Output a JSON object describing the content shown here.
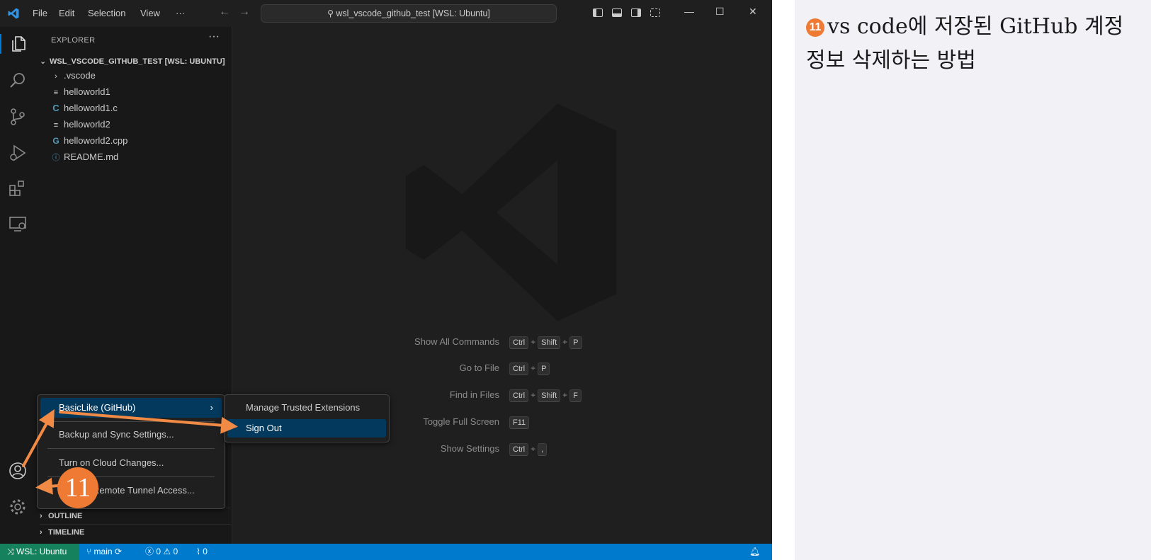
{
  "titlebar": {
    "menu": [
      "File",
      "Edit",
      "Selection",
      "View"
    ],
    "more": "···",
    "search_text": "wsl_vscode_github_test [WSL: Ubuntu]"
  },
  "sidebar": {
    "title": "EXPLORER",
    "more": "···",
    "root": "WSL_VSCODE_GITHUB_TEST [WSL: UBUNTU]",
    "files": [
      {
        "name": ".vscode",
        "icon": "chevron-right-icon"
      },
      {
        "name": "helloworld1",
        "icon": "text-file-icon"
      },
      {
        "name": "helloworld1.c",
        "icon": "c-file-icon"
      },
      {
        "name": "helloworld2",
        "icon": "text-file-icon"
      },
      {
        "name": "helloworld2.cpp",
        "icon": "cpp-file-icon"
      },
      {
        "name": "README.md",
        "icon": "info-icon"
      }
    ],
    "outline": "OUTLINE",
    "timeline": "TIMELINE"
  },
  "editor": {
    "shortcuts": [
      {
        "label": "Show All Commands",
        "keys": [
          "Ctrl",
          "Shift",
          "P"
        ]
      },
      {
        "label": "Go to File",
        "keys": [
          "Ctrl",
          "P"
        ]
      },
      {
        "label": "Find in Files",
        "keys": [
          "Ctrl",
          "Shift",
          "F"
        ]
      },
      {
        "label": "Toggle Full Screen",
        "keys": [
          "F11"
        ]
      },
      {
        "label": "Show Settings",
        "keys": [
          "Ctrl",
          ","
        ]
      }
    ]
  },
  "accounts_menu": {
    "items": [
      "BasicLike (GitHub)",
      "Backup and Sync Settings...",
      "Turn on Cloud Changes...",
      "Turn on Remote Tunnel Access..."
    ],
    "submenu": [
      "Manage Trusted Extensions",
      "Sign Out"
    ]
  },
  "statusbar": {
    "remote": "WSL: Ubuntu",
    "branch": "main",
    "errors": "0",
    "warnings": "0",
    "ports": "0"
  },
  "annotation": {
    "badge": "11"
  },
  "note": {
    "badge": "11",
    "text": "vs code에 저장된 GitHub 계정정보 삭제하는 방법"
  }
}
